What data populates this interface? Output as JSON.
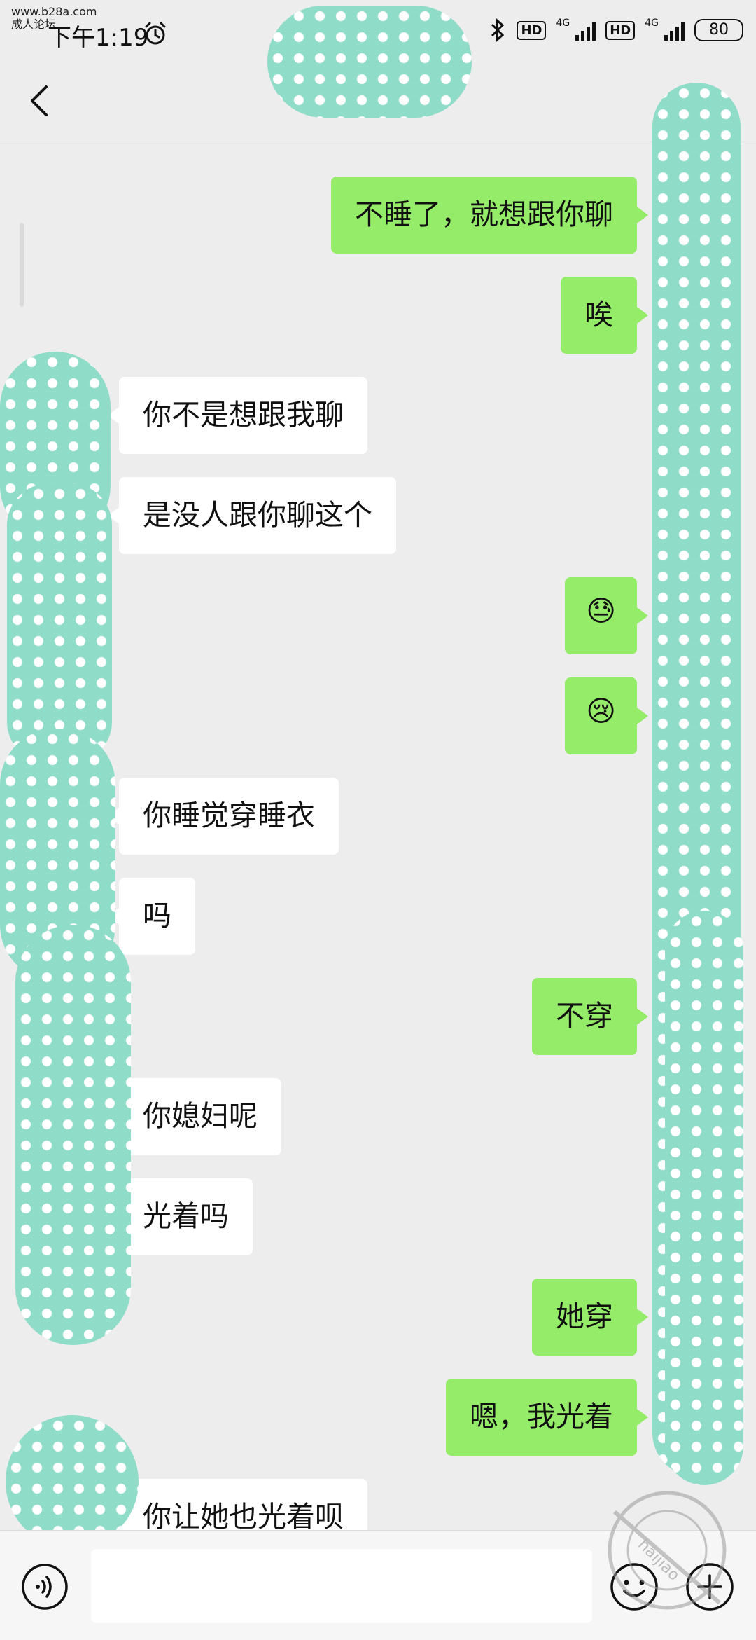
{
  "status_bar": {
    "watermark_line1": "www.b28a.com",
    "watermark_line2": "成人论坛",
    "time": "下午1:19",
    "hd_label": "HD",
    "network_label": "4G",
    "battery": "80"
  },
  "messages": [
    {
      "side": "out",
      "text": "不睡了，就想跟你聊"
    },
    {
      "side": "out",
      "text": "唉"
    },
    {
      "side": "in",
      "text": "你不是想跟我聊"
    },
    {
      "side": "in",
      "text": "是没人跟你聊这个"
    },
    {
      "side": "out",
      "text": "😓"
    },
    {
      "side": "out",
      "text": "😢"
    },
    {
      "side": "in",
      "text": "你睡觉穿睡衣"
    },
    {
      "side": "in",
      "text": "吗"
    },
    {
      "side": "out",
      "text": "不穿"
    },
    {
      "side": "in",
      "text": "你媳妇呢"
    },
    {
      "side": "in",
      "text": "光着吗"
    },
    {
      "side": "out",
      "text": "她穿"
    },
    {
      "side": "out",
      "text": "嗯，我光着"
    },
    {
      "side": "in",
      "text": "你让她也光着呗"
    }
  ],
  "watermark_bottom": "haijiao",
  "colors": {
    "outgoing_bubble": "#95ec69",
    "incoming_bubble": "#ffffff",
    "background": "#ededed",
    "redaction": "#8fdcc8"
  }
}
